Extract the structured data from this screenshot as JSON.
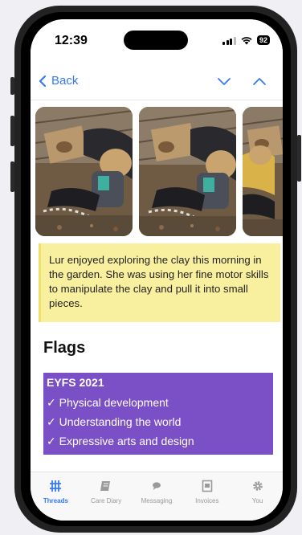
{
  "status": {
    "time": "12:39",
    "battery": "92"
  },
  "nav": {
    "back_label": "Back"
  },
  "photos": [
    {
      "name": "photo-1"
    },
    {
      "name": "photo-2"
    },
    {
      "name": "photo-3"
    }
  ],
  "note": "Lur enjoyed exploring the clay this morning in the garden. She was using her fine motor skills to manipulate the clay and pull it into small pieces.",
  "flags": {
    "title": "Flags",
    "heading": "EYFS 2021",
    "items": [
      "✓ Physical development",
      "✓ Understanding the world",
      "✓ Expressive arts and design"
    ]
  },
  "tabs": [
    {
      "label": "Threads",
      "icon": "threads-icon",
      "active": true
    },
    {
      "label": "Care Diary",
      "icon": "book-icon",
      "active": false
    },
    {
      "label": "Messaging",
      "icon": "chat-bubble-icon",
      "active": false
    },
    {
      "label": "Invoices",
      "icon": "invoice-icon",
      "active": false
    },
    {
      "label": "You",
      "icon": "gear-icon",
      "active": false
    }
  ],
  "colors": {
    "accent": "#3478f6",
    "note_bg": "#f8ef9f",
    "flags_bg": "#7b4fc6"
  }
}
